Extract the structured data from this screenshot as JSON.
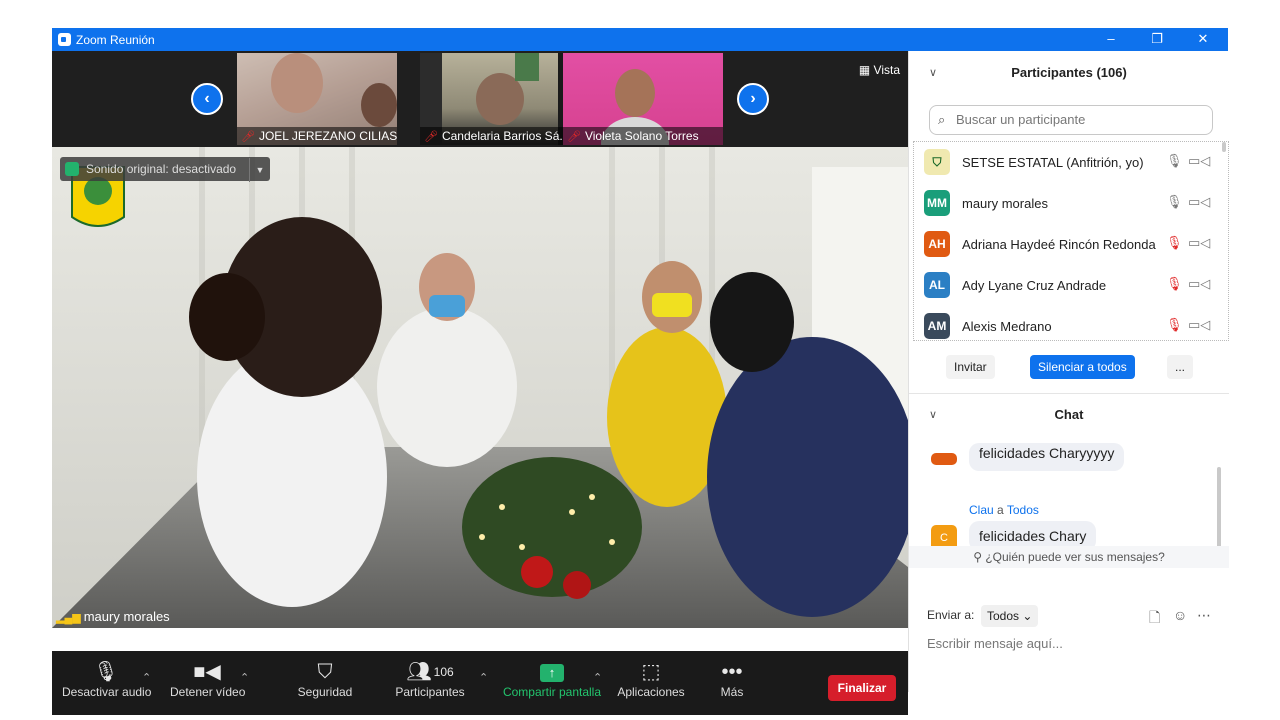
{
  "window": {
    "title": "Zoom Reunión",
    "controls": [
      "–",
      "❐",
      "✕"
    ]
  },
  "strip": {
    "thumbnails": [
      {
        "name": "JOEL JEREZANO CILIAS"
      },
      {
        "name": "Candelaria Barrios Sá..."
      },
      {
        "name": "Violeta Solano Torres"
      }
    ],
    "vista_label": "Vista"
  },
  "main": {
    "original_sound": "Sonido original: desactivado",
    "speaker": "maury morales"
  },
  "toolbar": {
    "audio": "Desactivar audio",
    "video": "Detener vídeo",
    "security": "Seguridad",
    "participants": "Participantes",
    "participants_count": "106",
    "share": "Compartir pantalla",
    "apps": "Aplicaciones",
    "more": "Más",
    "end": "Finalizar"
  },
  "participants_panel": {
    "title": "Participantes (106)",
    "search_placeholder": "Buscar un participante",
    "list": [
      {
        "initials": "",
        "name": "SETSE ESTATAL (Anfitrión, yo)",
        "color": "#f0e9b0",
        "muted": false
      },
      {
        "initials": "MM",
        "name": "maury morales",
        "color": "#1a9e7a",
        "muted": false
      },
      {
        "initials": "AH",
        "name": "Adriana Haydeé Rincón Redonda",
        "color": "#e05a12",
        "muted": true
      },
      {
        "initials": "AL",
        "name": "Ady Lyane Cruz Andrade",
        "color": "#2b7fc4",
        "muted": true
      },
      {
        "initials": "AM",
        "name": "Alexis Medrano",
        "color": "#3a4a5c",
        "muted": true
      }
    ],
    "buttons": {
      "invite": "Invitar",
      "mute_all": "Silenciar a todos",
      "more": "..."
    }
  },
  "chat": {
    "title": "Chat",
    "messages": [
      {
        "text": "felicidades Charyyyyy"
      },
      {
        "from": "Clau",
        "a": "a",
        "to": "Todos",
        "text": "felicidades Chary",
        "initial": "C",
        "color": "#f39c12"
      }
    ],
    "who_can_see": "¿Quién puede ver sus mensajes?",
    "send_to_label": "Enviar a:",
    "send_to_value": "Todos",
    "input_placeholder": "Escribir mensaje aquí..."
  }
}
